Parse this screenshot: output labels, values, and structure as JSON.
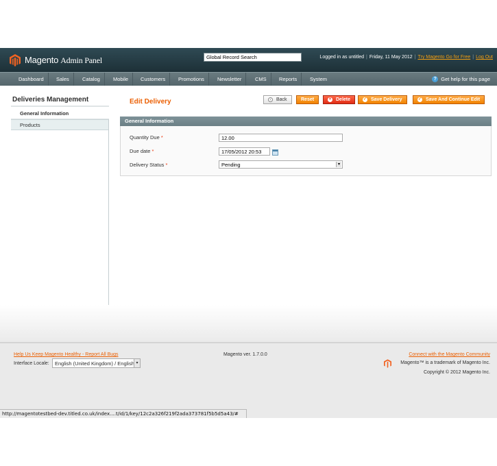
{
  "header": {
    "brand": "Magento",
    "panel_title": "Admin Panel",
    "global_search_value": "Global Record Search",
    "logged_in": "Logged in as untitled",
    "date": "Friday, 11 May 2012",
    "try_link": "Try Magento Go for Free",
    "logout": "Log Out"
  },
  "nav": {
    "items": [
      "Dashboard",
      "Sales",
      "Catalog",
      "Mobile",
      "Customers",
      "Promotions",
      "Newsletter",
      "CMS",
      "Reports",
      "System"
    ],
    "help": "Get help for this page"
  },
  "sidebar": {
    "title": "Deliveries Management",
    "tabs": [
      "General Information",
      "Products"
    ]
  },
  "content": {
    "title": "Edit Delivery",
    "buttons": {
      "back": "Back",
      "reset": "Reset",
      "delete": "Delete",
      "save": "Save Delivery",
      "save_continue": "Save And Continue Edit"
    },
    "section_title": "General Information",
    "fields": {
      "quantity_label": "Quantity Due",
      "quantity_value": "12.00",
      "due_date_label": "Due date",
      "due_date_value": "17/05/2012 20:53",
      "status_label": "Delivery Status",
      "status_value": "Pending"
    },
    "required_mark": "*"
  },
  "footer": {
    "help_link": "Help Us Keep Magento Healthy - Report All Bugs",
    "locale_label": "Interface Locale:",
    "locale_value": "English (United Kingdom) / English",
    "version": "Magento ver. 1.7.0.0",
    "community_link": "Connect with the Magento Community",
    "trademark": "Magento™ is a trademark of Magento Inc.",
    "copyright": "Copyright © 2012 Magento Inc."
  },
  "statusbar": {
    "url": "http://magentotestbed-dev.titled.co.uk/index....t/id/1/key/12c2a326f219f2ada373781f5b5d5a43/#"
  },
  "colors": {
    "accent": "#eb5e00",
    "header_bg": "#1d3037",
    "nav_bg": "#5f7076",
    "button_orange": "#f18200",
    "button_red": "#e12b14"
  }
}
